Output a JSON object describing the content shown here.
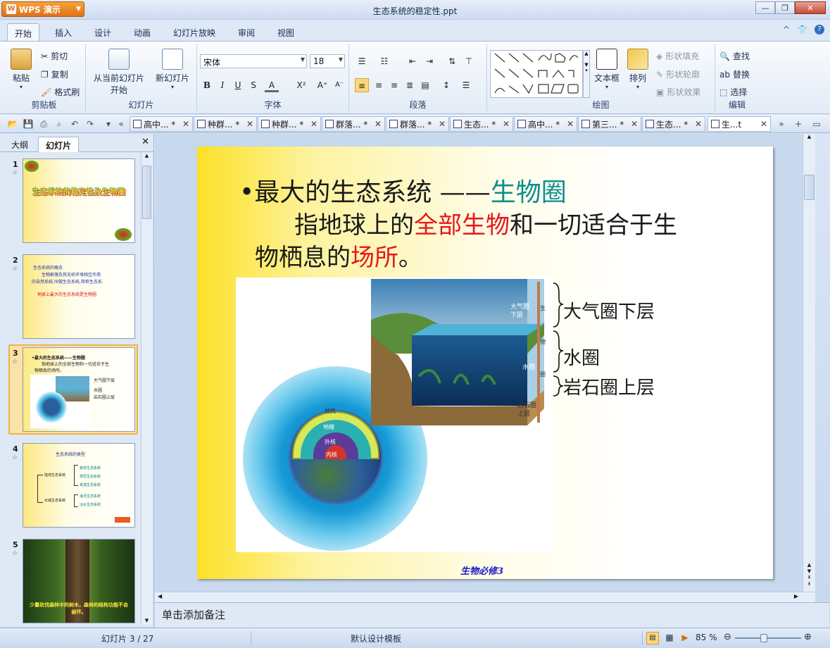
{
  "app": {
    "button_label": "WPS 演示",
    "doc_title": "生态系统的稳定性.ppt"
  },
  "window_buttons": {
    "minimize": "—",
    "restore": "❐",
    "close": "✕"
  },
  "menu_tabs": [
    "开始",
    "插入",
    "设计",
    "动画",
    "幻灯片放映",
    "审阅",
    "视图"
  ],
  "topright": {
    "collapse": "^",
    "skin": "👕",
    "help": "?"
  },
  "ribbon": {
    "clipboard": {
      "paste": "粘贴",
      "cut": "剪切",
      "copy": "复制",
      "format_painter": "格式刷",
      "label": "剪贴板"
    },
    "slides": {
      "from_current": "从当前幻灯片",
      "from_current_2": "开始",
      "new_slide": "新幻灯片",
      "label": "幻灯片"
    },
    "font": {
      "name": "宋体",
      "size": "18",
      "label": "字体",
      "bold": "B",
      "italic": "I",
      "underline": "U",
      "shadow": "S",
      "color": "A",
      "superscript": "X²",
      "grow": "A⁺",
      "shrink": "A⁻"
    },
    "paragraph": {
      "label": "段落"
    },
    "drawing": {
      "textbox": "文本框",
      "arrange": "排列",
      "fill": "形状填充",
      "outline": "形状轮廓",
      "effect": "形状效果",
      "label": "绘图"
    },
    "editing": {
      "find": "查找",
      "replace": "替换",
      "select": "选择",
      "label": "编辑"
    }
  },
  "doc_tabs": [
    "高中... *",
    "种群... *",
    "种群... *",
    "群落... *",
    "群落... *",
    "生态... *",
    "高中... *",
    "第三... *",
    "生态... *",
    "生...t"
  ],
  "left_panel": {
    "tab_outline": "大纲",
    "tab_slides": "幻灯片",
    "close": "✕"
  },
  "thumbnails": [
    {
      "num": "1",
      "title": "生态系统的稳定性及生物圈"
    },
    {
      "num": "2",
      "line1": "生态系统的概念",
      "line2": "生物群落及其无机环境相互作用",
      "line3": "的自然系统,叫做生态系统,简称生态系.",
      "line4": "地球上最大的生态系统是生物圈"
    },
    {
      "num": "3",
      "line1": "•最大的生态系统——生物圈",
      "line2": "指地球上的全部生物和一切适合于生",
      "line3": "物栖息的场所。",
      "l1": "大气圈下层",
      "l2": "水圈",
      "l3": "岩石圈上层"
    },
    {
      "num": "4",
      "title": "生态系统的类型",
      "branch1": "陆地生态系统",
      "branch2": "水域生态系统",
      "items": [
        "森林生态系统",
        "草原生态系统",
        "荒漠生态系统",
        "海洋生态系统",
        "淡水生态系统"
      ]
    },
    {
      "num": "5",
      "caption": "少量砍伐森林中的树木，森林的结构功能不会破坏。"
    }
  ],
  "slide": {
    "bullet": "•",
    "heading_black": "最大的生态系统 ——",
    "heading_teal": "生物圈",
    "line1_a": "指地球上的",
    "line1_red": "全部生物",
    "line1_b": "和一切适合于生",
    "line2_a": "物栖息的",
    "line2_red": "场所",
    "line2_b": "。",
    "label1": "大气圈下层",
    "label2": "水圈",
    "label3": "岩石圈上层",
    "cube_atm": "大气圈",
    "cube_atm2": "下层",
    "cube_water": "水圈",
    "cube_rock": "岩石圈",
    "cube_rock2": "上层",
    "cube_bio": "生",
    "cube_bio2": "物",
    "cube_bio3": "圈",
    "earth_crust": "地壳",
    "earth_mantle": "地幔",
    "earth_outer": "外核",
    "earth_inner": "内核",
    "footer": "生物必修3"
  },
  "notes_placeholder": "单击添加备注",
  "status": {
    "slide_info": "幻灯片 3 / 27",
    "template": "默认设计模板",
    "zoom": "85 %"
  },
  "colors": {
    "teal": "#0a8f8f",
    "red": "#e8161b",
    "footer_blue": "#1a1ac8"
  }
}
